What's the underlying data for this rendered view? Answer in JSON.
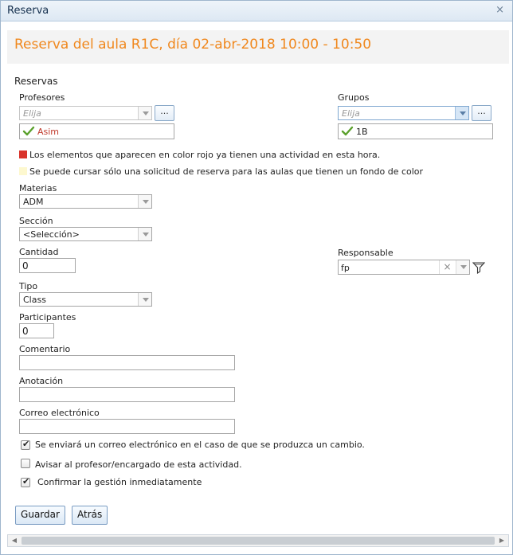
{
  "window": {
    "title": "Reserva",
    "close_glyph": "×"
  },
  "header": {
    "heading": "Reserva del aula R1C, día 02-abr-2018 10:00 - 10:50"
  },
  "reservas": {
    "label": "Reservas"
  },
  "profesores": {
    "label": "Profesores",
    "placeholder": "Elija",
    "browse_label": "...",
    "selected": "Asim",
    "selected_color": "#c0392b"
  },
  "grupos": {
    "label": "Grupos",
    "placeholder": "Elija",
    "browse_label": "...",
    "selected": "1B"
  },
  "legend": {
    "red_text": "Los elementos que aparecen en color rojo ya tienen una actividad en esta hora.",
    "red_color": "#d9342b",
    "yellow_text": "Se puede cursar sólo una solicitud de reserva para las aulas que tienen un fondo de color",
    "yellow_color": "#fdf8cf"
  },
  "materias": {
    "label": "Materias",
    "value": "ADM"
  },
  "seccion": {
    "label": "Sección",
    "value": "<Selección>"
  },
  "cantidad": {
    "label": "Cantidad",
    "value": "0"
  },
  "responsable": {
    "label": "Responsable",
    "value": "fp",
    "clear_glyph": "×"
  },
  "tipo": {
    "label": "Tipo",
    "value": "Class"
  },
  "participantes": {
    "label": "Participantes",
    "value": "0"
  },
  "comentario": {
    "label": "Comentario",
    "value": ""
  },
  "anotacion": {
    "label": "Anotación",
    "value": ""
  },
  "correo": {
    "label": "Correo electrónico",
    "value": ""
  },
  "options": [
    {
      "label": "Se enviará un correo electrónico en el caso de que se produzca un cambio.",
      "checked": true
    },
    {
      "label": "Avisar al profesor/encargado de esta actividad.",
      "checked": false
    },
    {
      "label": "Confirmar la gestión inmediatamente",
      "checked": true
    }
  ],
  "buttons": {
    "save": "Guardar",
    "back": "Atrás"
  },
  "scrollbar": {
    "left_glyph": "◀",
    "right_glyph": "▶"
  },
  "colors": {
    "accent": "#f0881e",
    "check_green": "#5aa02c"
  }
}
